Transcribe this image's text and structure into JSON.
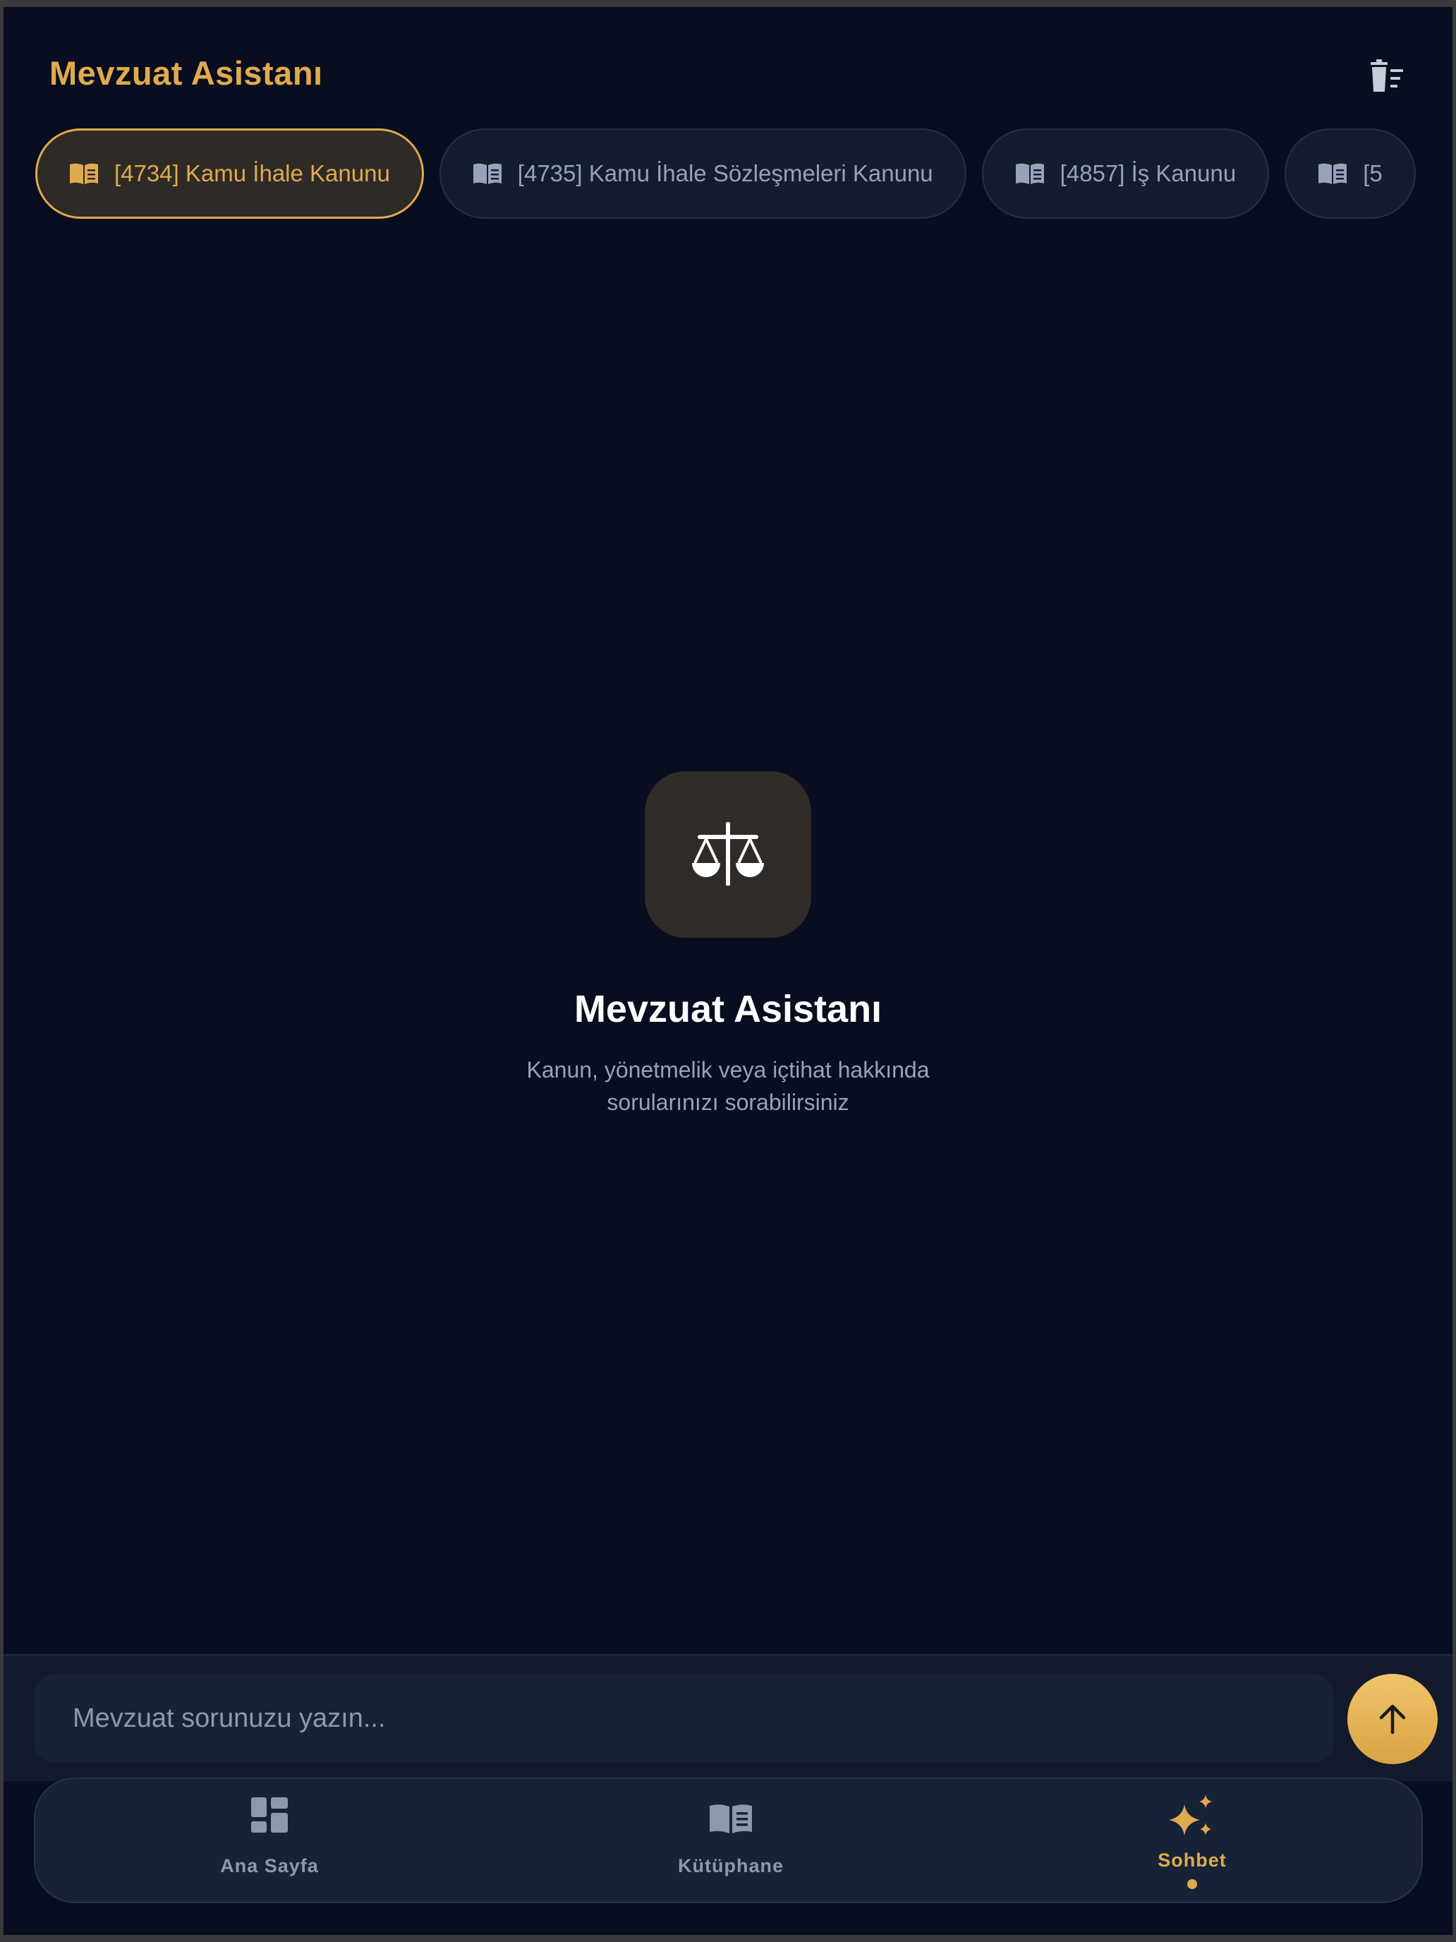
{
  "header": {
    "title": "Mevzuat Asistanı",
    "clear_icon": "clear-all-icon"
  },
  "chips": [
    {
      "label": "[4734] Kamu İhale Kanunu",
      "active": true
    },
    {
      "label": "[4735] Kamu İhale Sözleşmeleri Kanunu",
      "active": false
    },
    {
      "label": "[4857] İş Kanunu",
      "active": false
    },
    {
      "label": "[5",
      "active": false
    }
  ],
  "empty_state": {
    "icon": "scales-icon",
    "title": "Mevzuat Asistanı",
    "subtitle": "Kanun, yönetmelik veya içtihat hakkında sorularınızı sorabilirsiniz"
  },
  "composer": {
    "placeholder": "Mevzuat sorunuzu yazın...",
    "value": "",
    "send_icon": "arrow-up-icon"
  },
  "nav": {
    "items": [
      {
        "label": "Ana Sayfa",
        "icon": "dashboard-icon"
      },
      {
        "label": "Kütüphane",
        "icon": "book-icon"
      },
      {
        "label": "Sohbet",
        "icon": "sparkles-icon",
        "active": true
      }
    ]
  },
  "colors": {
    "background": "#080d1f",
    "accent": "#e0aa4e",
    "muted_text": "#98a2b8",
    "surface": "#182236"
  }
}
